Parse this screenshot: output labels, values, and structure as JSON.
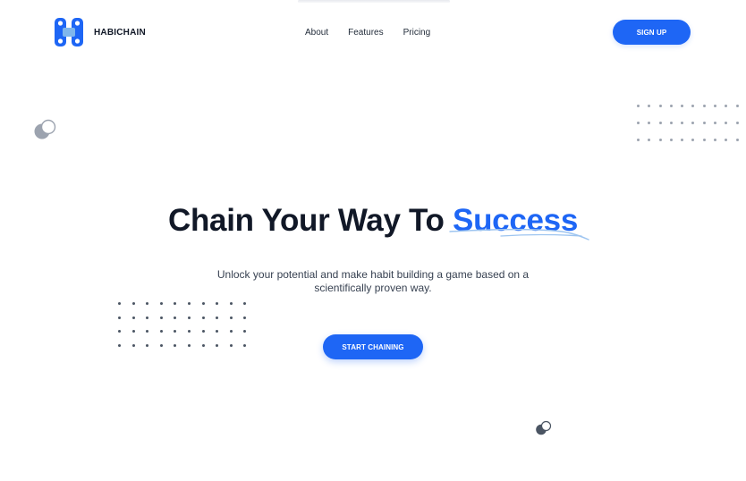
{
  "brand": {
    "name": "HABICHAIN",
    "logo_icon": "chain-link-icon",
    "color": "#1e66f5"
  },
  "nav": {
    "items": [
      {
        "label": "About"
      },
      {
        "label": "Features"
      },
      {
        "label": "Pricing"
      }
    ]
  },
  "header": {
    "signup_label": "SIGN UP"
  },
  "hero": {
    "title_main": "Chain Your Way To ",
    "title_accent": "Success",
    "subtitle": "Unlock your potential and make habit building a game based on a scientifically proven way.",
    "cta_label": "START CHAINING"
  },
  "colors": {
    "accent": "#1e66f5",
    "text_dark": "#111827",
    "text_body": "#374151"
  }
}
